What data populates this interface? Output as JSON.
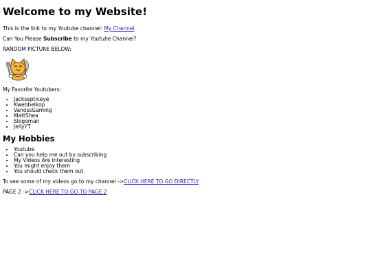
{
  "header": {
    "title": "Welcome to my Website!"
  },
  "intro": {
    "link_prefix": "This is the link to my Youtube channel: ",
    "channel_link": "My Channel",
    "link_suffix": ".",
    "subscribe_prefix": "Can You Please ",
    "subscribe_bold": "Subscribe",
    "subscribe_mid": " to my ",
    "subscribe_italic": "Youtube",
    "subscribe_suffix": " Channel?",
    "random_picture_label": "RANDOM PICTURE BELOW:"
  },
  "favorites": {
    "label": "My Favorite Youtubers:",
    "items": [
      "Jacksepticeye",
      "Kwebbelkop",
      "VanossGaming",
      "MattShea",
      "Slogoman",
      "JellyYT"
    ]
  },
  "hobbies": {
    "heading": "My Hobbies",
    "items": [
      "Youtube",
      "Can you help me out by subscribing",
      "My Videos Are Interesting",
      "You might enjoy them",
      "You should check them out"
    ]
  },
  "links": {
    "videos_prefix": "To see some of my videos go to my channel ->",
    "videos_link": "CLICK HERE TO GO DIRECTLY",
    "page2_prefix": "PAGE 2 ->",
    "page2_link": "CLICK HERE TO GO TO PAGE 2"
  },
  "colors": {
    "link": "#2a1fb0",
    "text": "#000000",
    "background": "#ffffff"
  }
}
